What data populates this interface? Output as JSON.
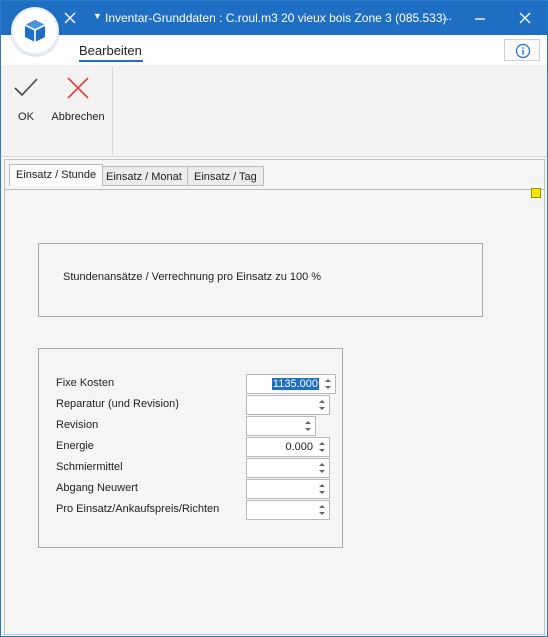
{
  "window": {
    "title": "Inventar-Grunddaten : C.roul.m3 20 vieux bois Zone 3 (085.533)",
    "ellipsis": "...",
    "accent": "#1e6fc4"
  },
  "ribbon": {
    "active_tab": "Bearbeiten",
    "ok_label": "OK",
    "cancel_label": "Abbrechen"
  },
  "tabs": [
    {
      "label": "Einsatz / Stunde",
      "active": true
    },
    {
      "label": "Einsatz / Monat",
      "active": false
    },
    {
      "label": "Einsatz / Tag",
      "active": false
    }
  ],
  "info_panel": {
    "text": "Stundenansätze / Verrechnung pro Einsatz zu 100 %"
  },
  "form": {
    "fields": [
      {
        "label": "Fixe Kosten",
        "value": "1135.000",
        "selected": true
      },
      {
        "label": "Reparatur (und Revision)",
        "value": ""
      },
      {
        "label": "Revision",
        "value": ""
      },
      {
        "label": "Energie",
        "value": "0.000"
      },
      {
        "label": "Schmiermittel",
        "value": ""
      },
      {
        "label": "Abgang Neuwert",
        "value": ""
      },
      {
        "label": "Pro Einsatz/Ankaufspreis/Richten",
        "value": ""
      }
    ]
  }
}
